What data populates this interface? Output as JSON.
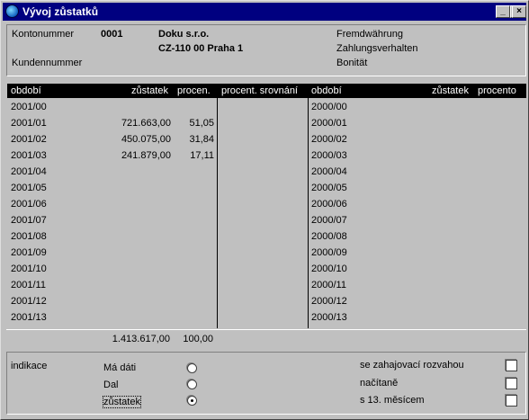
{
  "window": {
    "title": "Vývoj zůstatků"
  },
  "header": {
    "account_label": "Kontonummer",
    "account_number": "0001",
    "company_name": "Doku s.r.o.",
    "company_address": "CZ-110 00 Praha 1",
    "customer_label": "Kundennummer",
    "foreign_currency_label": "Fremdwährung",
    "payment_behavior_label": "Zahlungsverhalten",
    "credit_label": "Bonität"
  },
  "grid": {
    "columns": {
      "period_left": "období",
      "balance_left": "zůstatek",
      "percent_left": "procen.",
      "percent_compare": "procent. srovnání",
      "period_right": "období",
      "balance_right": "zůstatek",
      "percent_right": "procento"
    },
    "rows": [
      {
        "period": "2001/00",
        "balance": "",
        "percent": "",
        "prev_period": "2000/00"
      },
      {
        "period": "2001/01",
        "balance": "721.663,00",
        "percent": "51,05",
        "prev_period": "2000/01"
      },
      {
        "period": "2001/02",
        "balance": "450.075,00",
        "percent": "31,84",
        "prev_period": "2000/02"
      },
      {
        "period": "2001/03",
        "balance": "241.879,00",
        "percent": "17,11",
        "prev_period": "2000/03"
      },
      {
        "period": "2001/04",
        "balance": "",
        "percent": "",
        "prev_period": "2000/04"
      },
      {
        "period": "2001/05",
        "balance": "",
        "percent": "",
        "prev_period": "2000/05"
      },
      {
        "period": "2001/06",
        "balance": "",
        "percent": "",
        "prev_period": "2000/06"
      },
      {
        "period": "2001/07",
        "balance": "",
        "percent": "",
        "prev_period": "2000/07"
      },
      {
        "period": "2001/08",
        "balance": "",
        "percent": "",
        "prev_period": "2000/08"
      },
      {
        "period": "2001/09",
        "balance": "",
        "percent": "",
        "prev_period": "2000/09"
      },
      {
        "period": "2001/10",
        "balance": "",
        "percent": "",
        "prev_period": "2000/10"
      },
      {
        "period": "2001/11",
        "balance": "",
        "percent": "",
        "prev_period": "2000/11"
      },
      {
        "period": "2001/12",
        "balance": "",
        "percent": "",
        "prev_period": "2000/12"
      },
      {
        "period": "2001/13",
        "balance": "",
        "percent": "",
        "prev_period": "2000/13"
      }
    ],
    "total": {
      "balance": "1.413.617,00",
      "percent": "100,00"
    }
  },
  "indication": {
    "label": "indikace",
    "options": [
      {
        "label": "Má dáti",
        "selected": false
      },
      {
        "label": "Dal",
        "selected": false
      },
      {
        "label": "zůstatek",
        "selected": true
      }
    ],
    "checkboxes": [
      {
        "label": "se zahajovací rozvahou",
        "checked": false
      },
      {
        "label": "načítaně",
        "checked": false
      },
      {
        "label": "s 13. měsícem",
        "checked": false
      }
    ]
  }
}
